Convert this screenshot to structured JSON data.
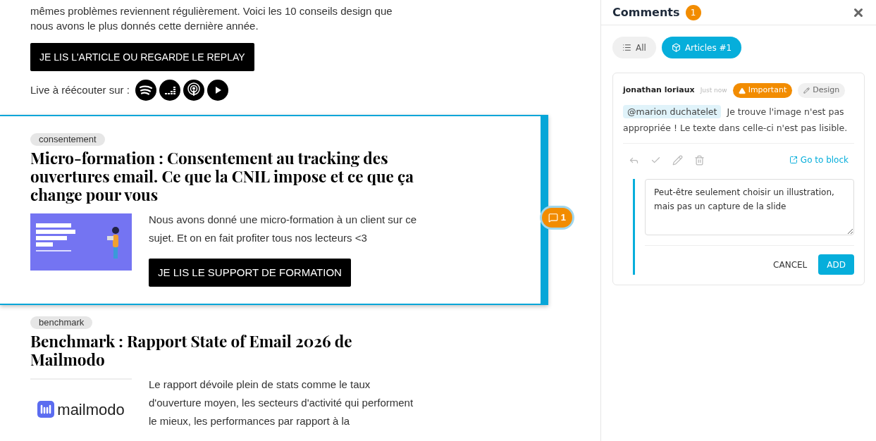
{
  "intro": {
    "text": "mêmes problèmes reviennent régulièrement. Voici les 10 conseils design que nous avons le plus donnés cette dernière année.",
    "button": "JE LIS L'ARTICLE OU REGARDE LE REPLAY",
    "listen_label": "Live à réécouter sur :"
  },
  "articles": [
    {
      "tag": "consentement",
      "title": "Micro-formation : Consentement au tracking des ouvertures email. Ce que la CNIL impose et ce que ça change pour vous",
      "text": "Nous avons donné une micro-formation à un client sur ce sujet. Et on en fait profiter tous nos lecteurs <3",
      "button": "JE LIS LE SUPPORT DE FORMATION",
      "selected": true,
      "comment_count": "1"
    },
    {
      "tag": "benchmark",
      "title": "Benchmark : Rapport State of Email 2026 de Mailmodo",
      "text": "Le rapport dévoile plein de stats comme le taux d'ouverture moyen, les secteurs d'activité qui performent le mieux, les performances par rapport à la",
      "selected": false,
      "thumb": {
        "kind": "logo",
        "label": "mailmodo"
      }
    }
  ],
  "panel": {
    "title": "Comments",
    "count": "1",
    "filters": [
      {
        "label": "All",
        "selected": false
      },
      {
        "label": "Articles #1",
        "selected": true
      }
    ],
    "comment": {
      "author": "jonathan loriaux",
      "time": "Just now",
      "tags": [
        {
          "kind": "important",
          "label": "Important"
        },
        {
          "kind": "category",
          "label": "Design"
        }
      ],
      "mention": "@marion duchatelet",
      "text": "Je trouve l'image n'est pas appropriée ! Le texte dans celle-ci n'est pas lisible.",
      "link": "Go to block"
    },
    "reply": {
      "value": "Peut-être seulement choisir un illustration, mais pas un capture de la slide",
      "cancel": "CANCEL",
      "add": "ADD"
    }
  }
}
